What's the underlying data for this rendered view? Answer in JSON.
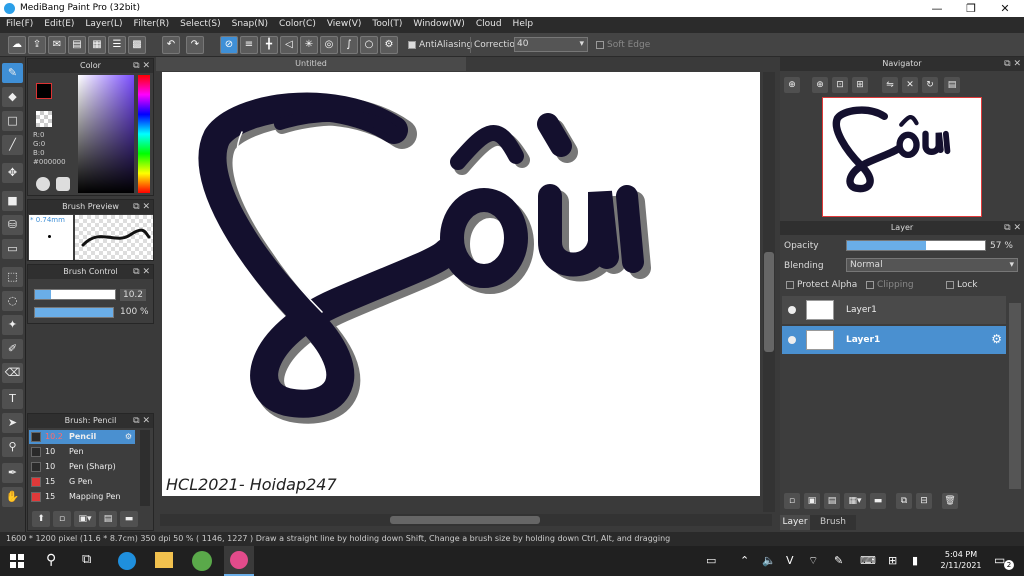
{
  "app": {
    "title": "MediBang Paint Pro (32bit)"
  },
  "menu": [
    "File(F)",
    "Edit(E)",
    "Layer(L)",
    "Filter(R)",
    "Select(S)",
    "Snap(N)",
    "Color(C)",
    "View(V)",
    "Tool(T)",
    "Window(W)",
    "Cloud",
    "Help"
  ],
  "toolbar": {
    "antialias_label": "AntiAliasing",
    "correction_label": "Correction",
    "correction_value": "40",
    "softedge_label": "Soft Edge"
  },
  "color_panel": {
    "title": "Color",
    "r": "R:0",
    "g": "G:0",
    "b": "B:0",
    "hex": "#000000"
  },
  "brush_preview": {
    "title": "Brush Preview",
    "size": "* 0.74mm"
  },
  "brush_control": {
    "title": "Brush Control",
    "size": "10.2",
    "opacity": "100 %"
  },
  "brush_list": {
    "title": "Brush: Pencil",
    "items": [
      {
        "size": "10.2",
        "name": "Pencil",
        "color": "#2a2a2a"
      },
      {
        "size": "10",
        "name": "Pen",
        "color": "#2a2a2a"
      },
      {
        "size": "10",
        "name": "Pen (Sharp)",
        "color": "#2a2a2a"
      },
      {
        "size": "15",
        "name": "G Pen",
        "color": "#e03a3a"
      },
      {
        "size": "15",
        "name": "Mapping Pen",
        "color": "#e03a3a"
      }
    ]
  },
  "canvas": {
    "tab": "Untitled",
    "artwork_text": "Sôiu",
    "signature": "HCL2021- Hoidap247"
  },
  "navigator": {
    "title": "Navigator"
  },
  "layer_panel": {
    "title": "Layer",
    "opacity_label": "Opacity",
    "opacity_value": "57 %",
    "opacity_fraction": 0.57,
    "blending_label": "Blending",
    "blending_value": "Normal",
    "protect_alpha": "Protect Alpha",
    "clipping": "Clipping",
    "lock": "Lock",
    "layers": [
      {
        "name": "Layer1"
      },
      {
        "name": "Layer1"
      }
    ],
    "bottom_tabs": [
      "Layer",
      "Brush Size"
    ]
  },
  "status": {
    "text": "1600 * 1200 pixel   (11.6 * 8.7cm)   350 dpi   50 %   ( 1146, 1227 )   Draw a straight line by holding down Shift, Change a brush size by holding down Ctrl, Alt, and dragging"
  },
  "taskbar": {
    "time": "5:04 PM",
    "date": "2/11/2021",
    "notif": "2"
  },
  "colors": {
    "accent": "#3f8fd6",
    "ink": "#14102e"
  }
}
